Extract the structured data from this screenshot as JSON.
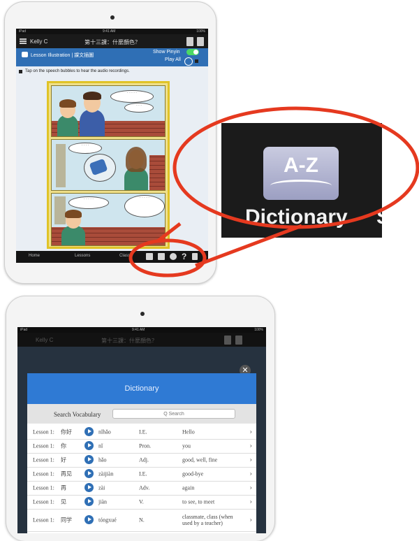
{
  "ipad_top": {
    "status": {
      "carrier": "iPad",
      "time": "9:41 AM",
      "battery": "100%"
    },
    "topbar": {
      "user": "Kelly C",
      "title": "第十三課：什麼顏色？"
    },
    "lesson_bar": {
      "title": "Lesson Illustration | 課文插圖",
      "show_pinyin": "Show Pinyin",
      "play_all": "Play All"
    },
    "instruction": "Tap on the speech bubbles to hear the audio recordings.",
    "tabs": [
      {
        "label": "Home"
      },
      {
        "label": "Lessons"
      },
      {
        "label": "Class"
      }
    ],
    "toolbar_icons": [
      "grid-icon",
      "dictionary-icon",
      "settings-icon",
      "help-icon",
      "share-icon"
    ]
  },
  "callout": {
    "icon_text": "A-Z",
    "label": "Dictionary"
  },
  "ipad_bottom": {
    "status": {
      "carrier": "iPad",
      "time": "9:41 AM",
      "battery": "100%"
    },
    "topbar": {
      "user": "Kelly C",
      "title": "第十三課：什麼顏色？"
    },
    "dictionary": {
      "title": "Dictionary",
      "search_label": "Search Vocabulary",
      "search_placeholder": "Q Search",
      "rows": [
        {
          "lesson": "Lesson 1:",
          "hanzi": "你好",
          "pinyin": "nǐhǎo",
          "pos": "I.E.",
          "def": "Hello"
        },
        {
          "lesson": "Lesson 1:",
          "hanzi": "你",
          "pinyin": "nǐ",
          "pos": "Pron.",
          "def": "you"
        },
        {
          "lesson": "Lesson 1:",
          "hanzi": "好",
          "pinyin": "hǎo",
          "pos": "Adj.",
          "def": "good, well, fine"
        },
        {
          "lesson": "Lesson 1:",
          "hanzi": "再见",
          "pinyin": "zàijiàn",
          "pos": "I.E.",
          "def": "good-bye"
        },
        {
          "lesson": "Lesson 1:",
          "hanzi": "再",
          "pinyin": "zài",
          "pos": "Adv.",
          "def": "again"
        },
        {
          "lesson": "Lesson 1:",
          "hanzi": "见",
          "pinyin": "jiàn",
          "pos": "V.",
          "def": "to see, to meet"
        },
        {
          "lesson": "Lesson 1:",
          "hanzi": "同学",
          "pinyin": "tóngxué",
          "pos": "N.",
          "def": "classmate, class (when used by a teacher)"
        }
      ]
    }
  },
  "colors": {
    "accent_blue": "#2f7ad4",
    "callout_red": "#e5391f",
    "comic_frame": "#e0c327"
  }
}
